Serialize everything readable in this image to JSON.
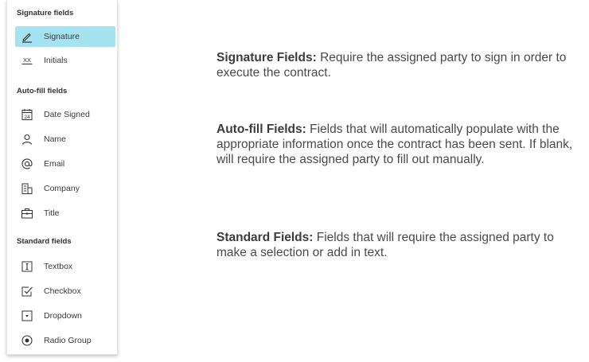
{
  "panel": {
    "sections": [
      {
        "title": "Signature fields",
        "items": [
          {
            "label": "Signature",
            "icon": "pen-icon",
            "active": true
          },
          {
            "label": "Initials",
            "icon": "initials-icon",
            "active": false
          }
        ]
      },
      {
        "title": "Auto-fill fields",
        "items": [
          {
            "label": "Date Signed",
            "icon": "calendar-icon",
            "calendar_day": "24"
          },
          {
            "label": "Name",
            "icon": "person-icon"
          },
          {
            "label": "Email",
            "icon": "at-icon"
          },
          {
            "label": "Company",
            "icon": "building-icon"
          },
          {
            "label": "Title",
            "icon": "briefcase-icon"
          }
        ]
      },
      {
        "title": "Standard fields",
        "items": [
          {
            "label": "Textbox",
            "icon": "textbox-icon"
          },
          {
            "label": "Checkbox",
            "icon": "checkbox-icon"
          },
          {
            "label": "Dropdown",
            "icon": "dropdown-icon"
          },
          {
            "label": "Radio Group",
            "icon": "radio-icon"
          }
        ]
      }
    ],
    "initials_glyph": "XX",
    "active_color": "#a6e3f0"
  },
  "descriptions": [
    {
      "term": "Signature Fields:",
      "text": "Require the assigned party to sign in order to execute the contract."
    },
    {
      "term": "Auto-fill Fields:",
      "text": "Fields that will automatically populate with the appropriate information once the contract has been sent. If blank, will require the assigned party to fill out manually."
    },
    {
      "term": "Standard Fields:",
      "text": "Fields that will require the assigned party to make a selection or add in text."
    }
  ]
}
